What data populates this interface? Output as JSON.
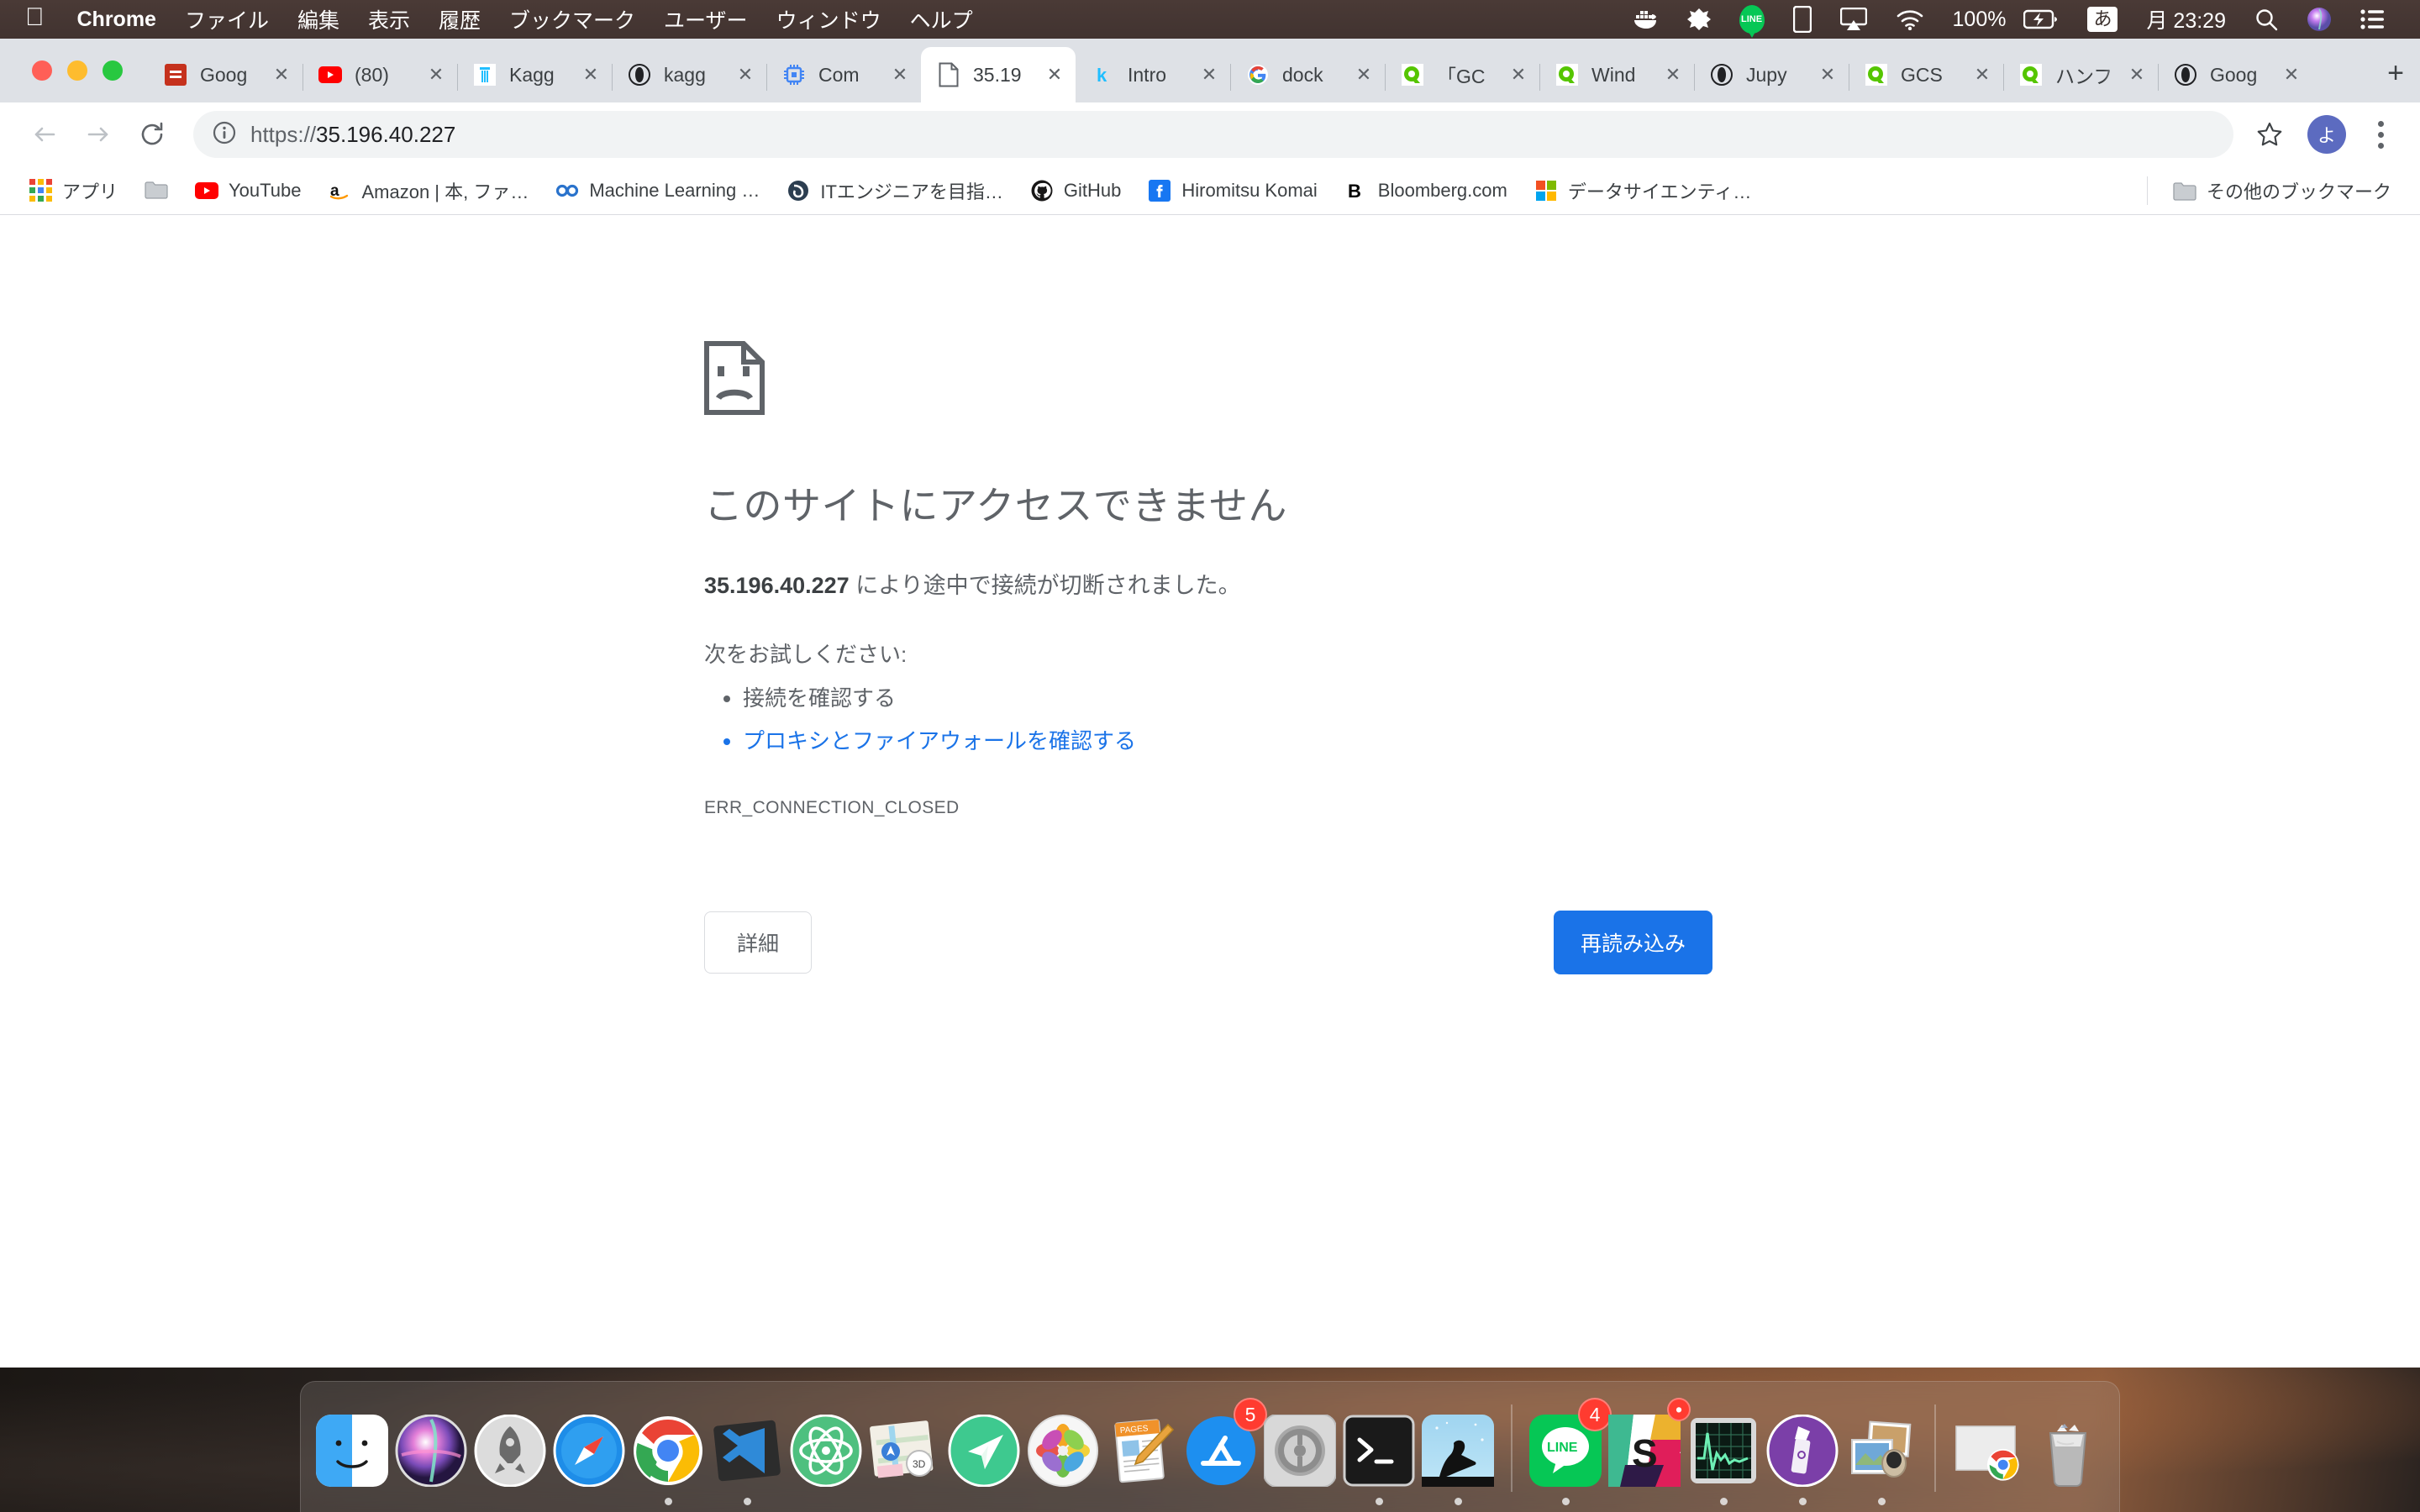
{
  "menubar": {
    "apple_icon": "apple-logo",
    "app_name": "Chrome",
    "items": [
      "ファイル",
      "編集",
      "表示",
      "履歴",
      "ブックマーク",
      "ユーザー",
      "ウィンドウ",
      "ヘルプ"
    ],
    "status": {
      "docker_icon": "docker-icon",
      "alfred_icon": "alfred-icon",
      "line_icon": "LINE",
      "display_icon": "display-icon",
      "airplay_icon": "airplay-icon",
      "wifi_icon": "wifi-icon",
      "battery_percent": "100%",
      "battery_icon": "battery-charging-icon",
      "input_method": "あ",
      "clock": "月 23:29",
      "spotlight_icon": "search-icon",
      "siri_icon": "siri-icon",
      "controlcenter_icon": "list-icon"
    }
  },
  "window": {
    "traffic_lights": [
      "close",
      "minimize",
      "zoom"
    ],
    "tabs": [
      {
        "title": "Goog",
        "favicon": "classroom-icon",
        "favicon_color": "#c5311d",
        "glyph": "C",
        "active": false
      },
      {
        "title": "(80)",
        "favicon": "youtube-icon",
        "favicon_color": "#ff0000",
        "glyph": "▶",
        "active": false
      },
      {
        "title": "Kagg",
        "favicon": "kaggle-icon",
        "favicon_color": "#20beff",
        "glyph": "K",
        "active": false
      },
      {
        "title": "kagg",
        "favicon": "jupyter-icon",
        "favicon_color": "#202124",
        "glyph": "◑",
        "active": false
      },
      {
        "title": "Com",
        "favicon": "chip-icon",
        "favicon_color": "#4285f4",
        "glyph": "▣",
        "active": false
      },
      {
        "title": "35.19",
        "favicon": "blank-page-icon",
        "favicon_color": "#5f6368",
        "glyph": "📄",
        "active": true
      },
      {
        "title": "Intro",
        "favicon": "kaggle-k-icon",
        "favicon_color": "#20beff",
        "glyph": "k",
        "active": false
      },
      {
        "title": "dock",
        "favicon": "google-icon",
        "favicon_color": "#4285f4",
        "glyph": "G",
        "active": false
      },
      {
        "title": "「GC",
        "favicon": "qiita-icon",
        "favicon_color": "#55c500",
        "glyph": "Q",
        "active": false
      },
      {
        "title": "Wind",
        "favicon": "qiita-icon",
        "favicon_color": "#55c500",
        "glyph": "Q",
        "active": false
      },
      {
        "title": "Jupy",
        "favicon": "jupyter-icon",
        "favicon_color": "#202124",
        "glyph": "◑",
        "active": false
      },
      {
        "title": "GCS",
        "favicon": "qiita-icon",
        "favicon_color": "#55c500",
        "glyph": "Q",
        "active": false
      },
      {
        "title": "ハンフ",
        "favicon": "qiita-icon",
        "favicon_color": "#55c500",
        "glyph": "Q",
        "active": false
      },
      {
        "title": "Goog",
        "favicon": "jupyter-icon",
        "favicon_color": "#202124",
        "glyph": "◑",
        "active": false
      }
    ],
    "new_tab_label": "+",
    "toolbar": {
      "back_icon": "back-arrow-icon",
      "forward_icon": "forward-arrow-icon",
      "reload_icon": "reload-icon",
      "security_icon": "info-circle-icon",
      "url_scheme": "https://",
      "url_host": "35.196.40.227",
      "url_full": "https://35.196.40.227",
      "star_icon": "bookmark-star-icon",
      "avatar_label": "よ",
      "menu_icon": "three-dot-menu-icon"
    },
    "bookmarks": [
      {
        "label": "アプリ",
        "icon": "apps-grid-icon"
      },
      {
        "label": "",
        "icon": "folder-icon"
      },
      {
        "label": "YouTube",
        "icon": "youtube-icon"
      },
      {
        "label": "Amazon | 本, ファ…",
        "icon": "amazon-icon"
      },
      {
        "label": "Machine Learning …",
        "icon": "coursera-icon"
      },
      {
        "label": "ITエンジニアを目指…",
        "icon": "teratail-icon"
      },
      {
        "label": "GitHub",
        "icon": "github-icon"
      },
      {
        "label": "Hiromitsu Komai",
        "icon": "facebook-icon"
      },
      {
        "label": "Bloomberg.com",
        "icon": "bloomberg-icon"
      },
      {
        "label": "データサイエンティ…",
        "icon": "microsoft-icon"
      }
    ],
    "other_bookmarks": {
      "label": "その他のブックマーク",
      "icon": "folder-icon"
    }
  },
  "error_page": {
    "icon": "sad-page-icon",
    "heading": "このサイトにアクセスできません",
    "message_host": "35.196.40.227",
    "message_rest": "により途中で接続が切断されました。",
    "suggestions_title": "次をお試しください:",
    "suggestions": [
      {
        "text": "接続を確認する",
        "is_link": false
      },
      {
        "text": "プロキシとファイアウォールを確認する",
        "is_link": true
      }
    ],
    "error_code": "ERR_CONNECTION_CLOSED",
    "detail_button": "詳細",
    "reload_button": "再読み込み",
    "link_color": "#1a73e8",
    "primary_button_color": "#1a73e8"
  },
  "dock": {
    "items": [
      {
        "name": "finder",
        "running": false
      },
      {
        "name": "siri",
        "running": false
      },
      {
        "name": "launchpad",
        "running": false
      },
      {
        "name": "safari",
        "running": false
      },
      {
        "name": "chrome",
        "running": true
      },
      {
        "name": "vscode",
        "running": true
      },
      {
        "name": "atom",
        "running": false
      },
      {
        "name": "maps",
        "running": false
      },
      {
        "name": "spark",
        "running": false
      },
      {
        "name": "photos",
        "running": false
      },
      {
        "name": "pages",
        "running": false
      },
      {
        "name": "app-store",
        "running": false,
        "badge": "5"
      },
      {
        "name": "system-preferences",
        "running": false
      },
      {
        "name": "terminal",
        "running": true
      },
      {
        "name": "kindle",
        "running": true
      },
      {
        "name": "line",
        "running": true,
        "badge": "4"
      },
      {
        "name": "slack",
        "running": false,
        "badge": "•"
      },
      {
        "name": "activity-monitor",
        "running": true
      },
      {
        "name": "keynote-purple",
        "running": true
      },
      {
        "name": "preview",
        "running": true
      },
      {
        "name": "minimized-chrome-window",
        "running": false
      },
      {
        "name": "trash",
        "running": false
      }
    ]
  }
}
